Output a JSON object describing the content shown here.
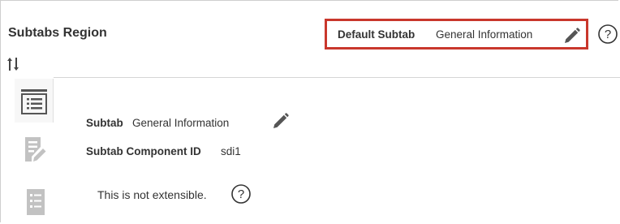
{
  "region": {
    "title": "Subtabs Region",
    "default_subtab": {
      "label": "Default Subtab",
      "value": "General Information"
    }
  },
  "subtab": {
    "label": "Subtab",
    "value": "General Information",
    "component_id_label": "Subtab Component ID",
    "component_id_value": "sdi1",
    "extensibility_note": "This is not extensible."
  },
  "tabs": [
    {
      "icon": "list-icon",
      "state": "active"
    },
    {
      "icon": "document-edit-icon",
      "state": "inactive"
    },
    {
      "icon": "checklist-icon",
      "state": "inactive"
    }
  ],
  "colors": {
    "highlight_border": "#c9372c",
    "icon": "#555555",
    "icon_muted": "#c2c2c2"
  }
}
